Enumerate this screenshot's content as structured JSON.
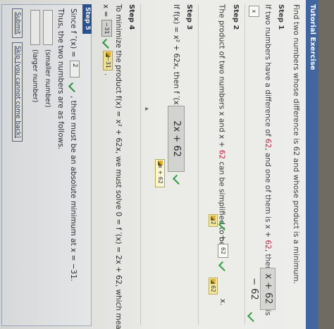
{
  "header": {
    "title": "Tutorial Exercise"
  },
  "problem": {
    "statement": "Find two numbers whose difference is 62 and whose product is a minimum."
  },
  "step1": {
    "title": "Step 1",
    "text_before": "If two numbers have a difference of ",
    "difference": "62",
    "text_middle": ", and one of them is x + ",
    "text_end": ", then the other is",
    "answer": "x + 62 − 62",
    "small_box_value": "x"
  },
  "step2": {
    "title": "Step 2",
    "text_before": "The product of two numbers x and x + ",
    "difference": "62",
    "text_after": " can be simplified to be x",
    "exponent": "2",
    "tile_exponent": "2",
    "plus": "+",
    "small_box_value": "62",
    "tile_coef": "62",
    "tail": "x."
  },
  "step3": {
    "title": "Step 3",
    "text": "If  f(x) = x² + 62x,  then  f ′(x) =",
    "answer": "2x + 62",
    "tile_value": "2x + 62"
  },
  "step4": {
    "title": "Step 4",
    "line1": "To minimize the product  f(x) = x² + 62x,  we must solve  0 = f ′(x) = 2x + 62,  which means",
    "x_label": "x =",
    "answer": "−31",
    "tile_value": "−31"
  },
  "step5": {
    "title": "Step 5",
    "since_text": "Since  f ″(x) =",
    "second_derivative_value": "2",
    "since_rest": ",  there must be an absolute minimum at x = −31.",
    "thus_text": "Thus, the two numbers are as follows.",
    "smaller_label": "(smaller number)",
    "larger_label": "(larger number)",
    "smaller_value": "",
    "larger_value": ""
  },
  "buttons": {
    "submit": "Submit",
    "skip": "Skip (you cannot come back)"
  }
}
